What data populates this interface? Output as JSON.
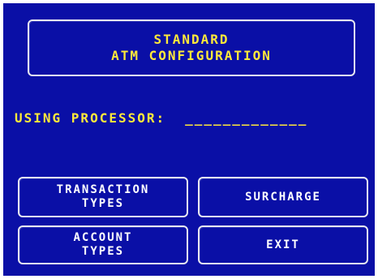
{
  "header": {
    "title_line1": "STANDARD",
    "title_line2": "ATM CONFIGURATION"
  },
  "processor": {
    "label": "USING PROCESSOR:",
    "value": "_____________"
  },
  "buttons": {
    "transaction_types": {
      "line1": "TRANSACTION",
      "line2": "TYPES"
    },
    "surcharge": {
      "label": "SURCHARGE"
    },
    "account_types": {
      "line1": "ACCOUNT",
      "line2": "TYPES"
    },
    "exit": {
      "label": "EXIT"
    }
  },
  "colors": {
    "background": "#0a0fa6",
    "title_text": "#ffe93a",
    "button_text": "#ffffff",
    "border": "#e8e8f0"
  }
}
